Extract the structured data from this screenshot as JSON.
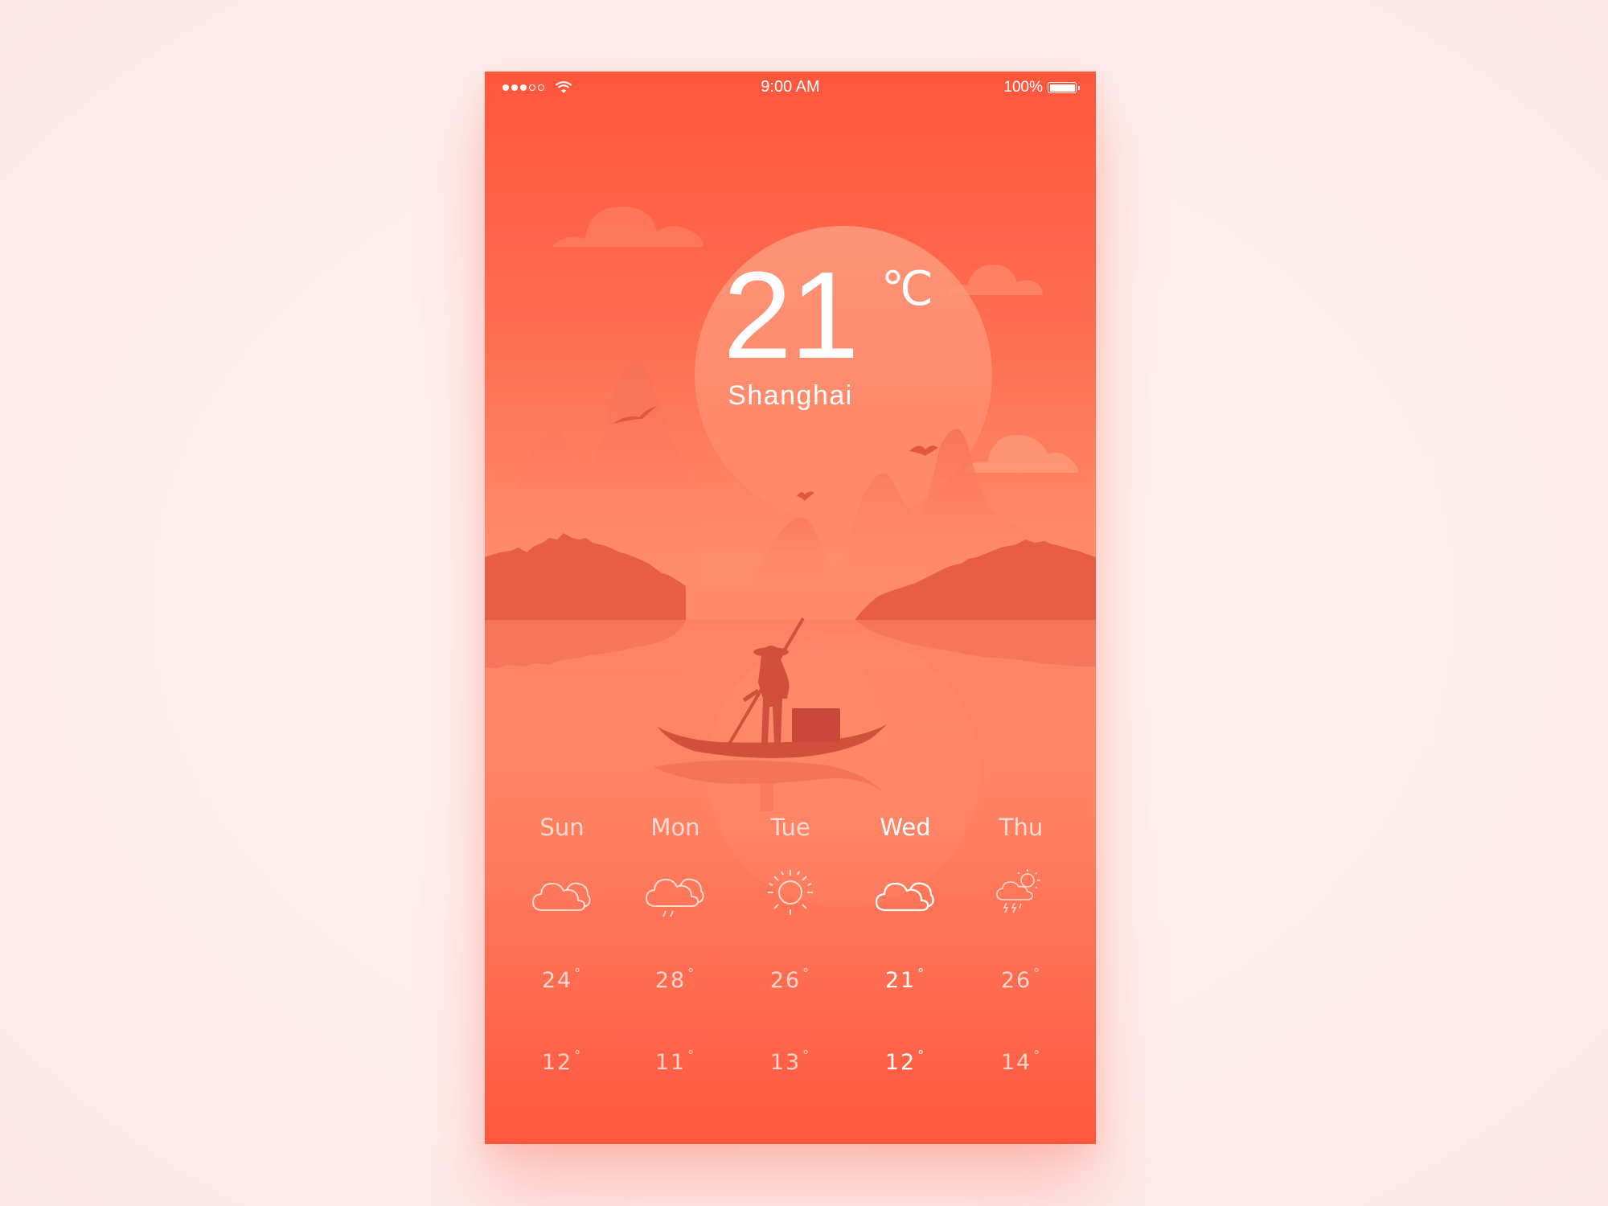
{
  "status_bar": {
    "time": "9:00 AM",
    "battery_percent": "100%",
    "signal_bars_filled": 3,
    "signal_bars_total": 5
  },
  "current": {
    "temperature": "21",
    "unit": "℃",
    "city": "Shanghai"
  },
  "forecast": [
    {
      "day": "Sun",
      "icon": "cloudy-icon",
      "high": "24",
      "low": "12",
      "active": false
    },
    {
      "day": "Mon",
      "icon": "cloud-rain-icon",
      "high": "28",
      "low": "11",
      "active": false
    },
    {
      "day": "Tue",
      "icon": "sun-icon",
      "high": "26",
      "low": "13",
      "active": false
    },
    {
      "day": "Wed",
      "icon": "cloudy-icon",
      "high": "21",
      "low": "12",
      "active": true
    },
    {
      "day": "Thu",
      "icon": "thunderstorm-sun-icon",
      "high": "26",
      "low": "14",
      "active": false
    }
  ],
  "degree_symbol": "°",
  "colors": {
    "accent": "#ff563c",
    "sky_light": "#ff8c6c",
    "sun": "#ff9a7c",
    "mountain": "#f06a50",
    "shore": "#e85a44",
    "boat": "#d24f3b",
    "page_bg": "#fdeeed"
  }
}
